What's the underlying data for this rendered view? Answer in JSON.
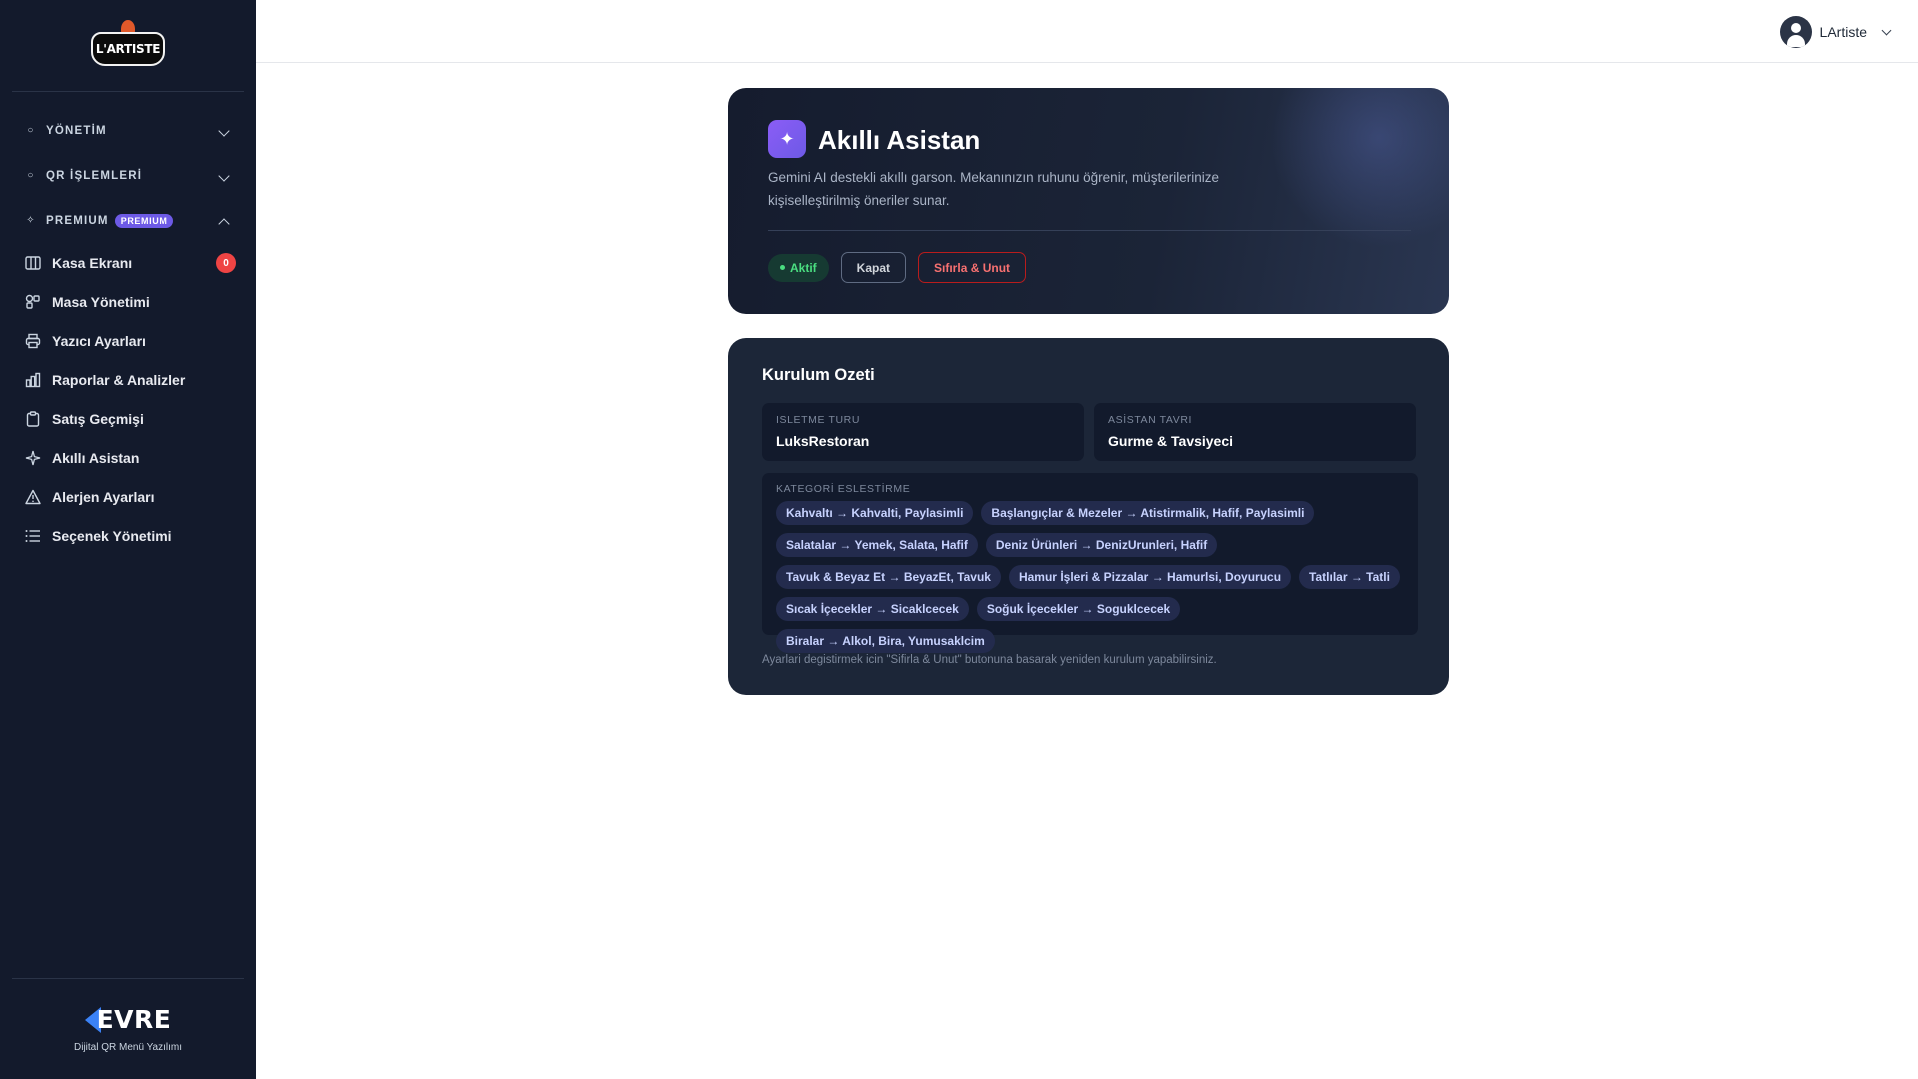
{
  "brand": {
    "logo_text": "L'ARTISTE"
  },
  "sidebar": {
    "sections": [
      {
        "label": "YÖNETİM",
        "expanded": false
      },
      {
        "label": "QR İŞLEMLERİ",
        "expanded": false
      },
      {
        "label": "PREMIUM",
        "badge": "PREMIUM",
        "expanded": true
      }
    ],
    "items": [
      {
        "label": "Kasa Ekranı",
        "icon": "columns-icon",
        "count": "0"
      },
      {
        "label": "Masa Yönetimi",
        "icon": "table-grid-icon"
      },
      {
        "label": "Yazıcı Ayarları",
        "icon": "printer-icon"
      },
      {
        "label": "Raporlar & Analizler",
        "icon": "bar-chart-icon"
      },
      {
        "label": "Satış Geçmişi",
        "icon": "clipboard-icon"
      },
      {
        "label": "Akıllı Asistan",
        "icon": "sparkle-icon"
      },
      {
        "label": "Alerjen Ayarları",
        "icon": "warning-icon"
      },
      {
        "label": "Seçenek Yönetimi",
        "icon": "list-icon"
      }
    ],
    "footer": {
      "brand": "EVRE",
      "subtitle": "Dijital QR Menü Yazılımı"
    }
  },
  "topbar": {
    "user_name": "LArtiste"
  },
  "hero": {
    "title": "Akıllı Asistan",
    "description": "Gemini AI destekli akıllı garson. Mekanınızın ruhunu öğrenir, müşterilerinize kişiselleştirilmiş öneriler sunar.",
    "status": "Aktif",
    "close_label": "Kapat",
    "reset_label": "Sıfırla & Unut"
  },
  "summary": {
    "title": "Kurulum Ozeti",
    "business_type_label": "ISLETME TURU",
    "business_type": "LuksRestoran",
    "assistant_tone_label": "ASİSTAN TAVRI",
    "assistant_tone": "Gurme & Tavsiyeci",
    "category_label": "KATEGORİ ESLESTİRME",
    "categories": [
      "Kahvaltı → Kahvalti, Paylasimli",
      "Başlangıçlar & Mezeler → Atistirmalik, Hafif, Paylasimli",
      "Salatalar → Yemek, Salata, Hafif",
      "Deniz Ürünleri → DenizUrunleri, Hafif",
      "Tavuk & Beyaz Et → BeyazEt, Tavuk",
      "Hamur İşleri & Pizzalar → Hamurlsi, Doyurucu",
      "Tatlılar → Tatli",
      "Sıcak İçecekler → Sicaklcecek",
      "Soğuk İçecekler → Soguklcecek",
      "Biralar → Alkol, Bira, Yumusaklcim"
    ],
    "note": "Ayarlari degistirmek icin \"Sifirla & Unut\" butonuna basarak yeniden kurulum yapabilirsiniz."
  },
  "colors": {
    "sidebar_bg": "#131a2c",
    "accent": "#6d5ae6",
    "active": "#4ade80",
    "danger": "#ef4444"
  }
}
